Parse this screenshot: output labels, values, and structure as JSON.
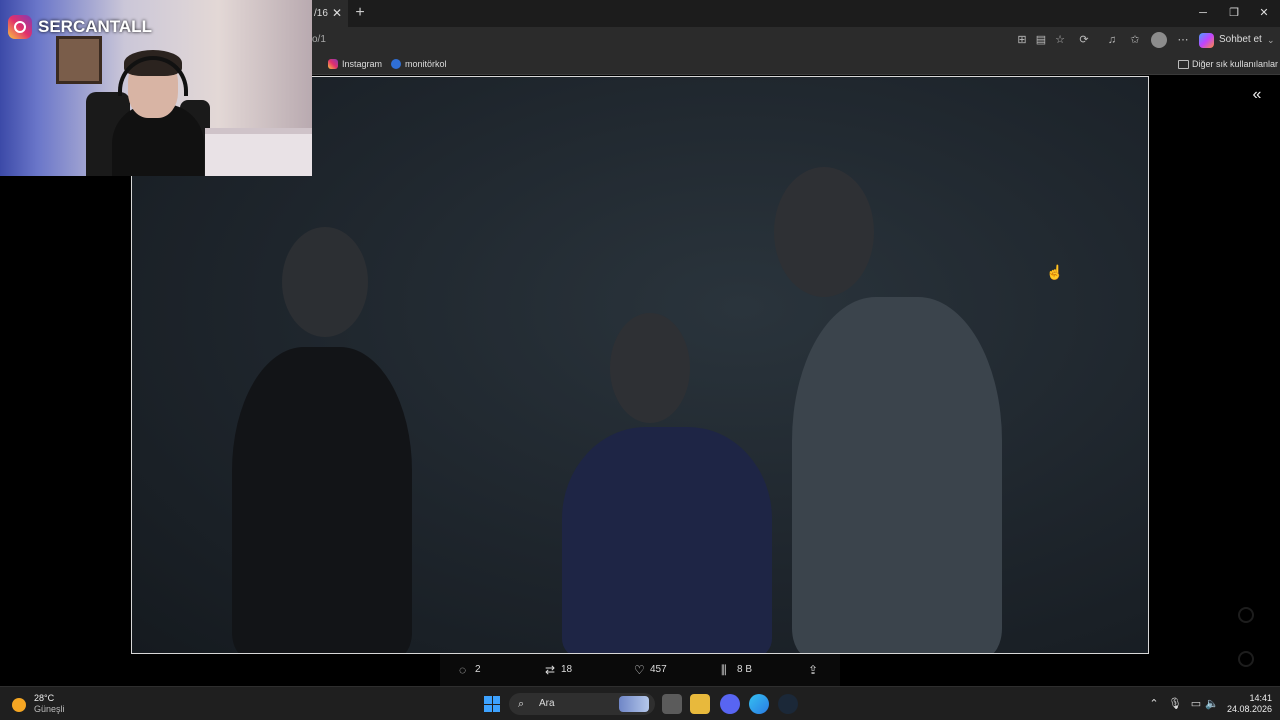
{
  "browser": {
    "tab_title": "/16",
    "tab_close": "✕",
    "new_tab": "+",
    "url": "o/1",
    "win_min": "─",
    "win_max": "❐",
    "win_close": "✕",
    "copilot_label": "Sohbet et",
    "bookmarks": [
      {
        "label": "Instagram",
        "icon": "instagram-icon"
      },
      {
        "label": "monitörkol",
        "icon": "verified-icon"
      }
    ],
    "other_bookmarks": "Diğer sık kullanılanlar"
  },
  "overlay": {
    "streamer_name": "SERCANTALL"
  },
  "post_actions": {
    "replies": "2",
    "reposts": "18",
    "likes": "457",
    "views": "8 B"
  },
  "taskbar": {
    "weather_temp": "28°C",
    "weather_cond": "Güneşli",
    "search_placeholder": "Ara",
    "time": "14:41",
    "date": "24.08.2026"
  }
}
